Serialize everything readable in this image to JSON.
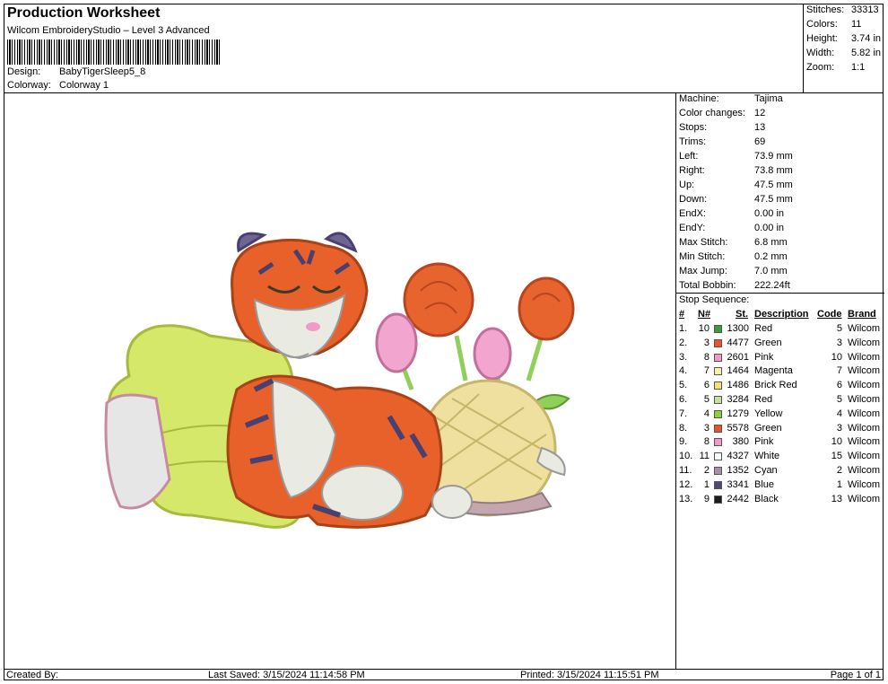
{
  "header": {
    "title": "Production Worksheet",
    "subtitle": "Wilcom EmbroideryStudio – Level 3 Advanced",
    "design_label": "Design:",
    "design_value": "BabyTigerSleep5_8",
    "colorway_label": "Colorway:",
    "colorway_value": "Colorway 1"
  },
  "top_stats": [
    {
      "label": "Stitches:",
      "value": "33313"
    },
    {
      "label": "Colors:",
      "value": "11"
    },
    {
      "label": "Height:",
      "value": "3.74 in"
    },
    {
      "label": "Width:",
      "value": "5.82 in"
    },
    {
      "label": "Zoom:",
      "value": "1:1"
    }
  ],
  "machine_stats": [
    {
      "label": "Machine:",
      "value": "Tajima"
    },
    {
      "label": "Color changes:",
      "value": "12"
    },
    {
      "label": "Stops:",
      "value": "13"
    },
    {
      "label": "Trims:",
      "value": "69"
    },
    {
      "label": "Left:",
      "value": "73.9 mm"
    },
    {
      "label": "Right:",
      "value": "73.8 mm"
    },
    {
      "label": "Up:",
      "value": "47.5 mm"
    },
    {
      "label": "Down:",
      "value": "47.5 mm"
    },
    {
      "label": "EndX:",
      "value": "0.00 in"
    },
    {
      "label": "EndY:",
      "value": "0.00 in"
    },
    {
      "label": "Max Stitch:",
      "value": "6.8 mm"
    },
    {
      "label": "Min Stitch:",
      "value": "0.2 mm"
    },
    {
      "label": "Max Jump:",
      "value": "7.0 mm"
    },
    {
      "label": "Total Bobbin:",
      "value": "222.24ft"
    }
  ],
  "stop_sequence": {
    "title": "Stop Sequence:",
    "columns": {
      "num": "#",
      "n": "N#",
      "st": "St.",
      "desc": "Description",
      "code": "Code",
      "brand": "Brand"
    },
    "rows": [
      {
        "num": "1.",
        "n": "10",
        "color": "#3c9a3a",
        "st": "1300",
        "desc": "Red",
        "code": "5",
        "brand": "Wilcom"
      },
      {
        "num": "2.",
        "n": "3",
        "color": "#e8532a",
        "st": "4477",
        "desc": "Green",
        "code": "3",
        "brand": "Wilcom"
      },
      {
        "num": "3.",
        "n": "8",
        "color": "#f29ac7",
        "st": "2601",
        "desc": "Pink",
        "code": "10",
        "brand": "Wilcom"
      },
      {
        "num": "4.",
        "n": "7",
        "color": "#faf0a8",
        "st": "1464",
        "desc": "Magenta",
        "code": "7",
        "brand": "Wilcom"
      },
      {
        "num": "5.",
        "n": "6",
        "color": "#f6e07a",
        "st": "1486",
        "desc": "Brick Red",
        "code": "6",
        "brand": "Wilcom"
      },
      {
        "num": "6.",
        "n": "5",
        "color": "#c9e29a",
        "st": "3284",
        "desc": "Red",
        "code": "5",
        "brand": "Wilcom"
      },
      {
        "num": "7.",
        "n": "4",
        "color": "#8fcf3a",
        "st": "1279",
        "desc": "Yellow",
        "code": "4",
        "brand": "Wilcom"
      },
      {
        "num": "8.",
        "n": "3",
        "color": "#e8532a",
        "st": "5578",
        "desc": "Green",
        "code": "3",
        "brand": "Wilcom"
      },
      {
        "num": "9.",
        "n": "8",
        "color": "#f29ac7",
        "st": "380",
        "desc": "Pink",
        "code": "10",
        "brand": "Wilcom"
      },
      {
        "num": "10.",
        "n": "11",
        "color": "#ffffff",
        "st": "4327",
        "desc": "White",
        "code": "15",
        "brand": "Wilcom"
      },
      {
        "num": "11.",
        "n": "2",
        "color": "#a78fa6",
        "st": "1352",
        "desc": "Cyan",
        "code": "2",
        "brand": "Wilcom"
      },
      {
        "num": "12.",
        "n": "1",
        "color": "#4a4a72",
        "st": "3341",
        "desc": "Blue",
        "code": "1",
        "brand": "Wilcom"
      },
      {
        "num": "13.",
        "n": "9",
        "color": "#1a1a1a",
        "st": "2442",
        "desc": "Black",
        "code": "13",
        "brand": "Wilcom"
      }
    ]
  },
  "footer": {
    "created": "Created By:",
    "last_saved": "Last Saved: 3/15/2024 11:14:58 PM",
    "printed": "Printed: 3/15/2024 11:15:51 PM",
    "page": "Page 1 of 1"
  },
  "colors": {
    "tiger_orange": "#e8602a",
    "stripe": "#4a4070",
    "pillow": "#d6e86a",
    "rose": "#e8642e",
    "tulip": "#f2a6cf",
    "stem": "#8fcf5a",
    "turtle": "#efe0a0",
    "fur": "#e9ebe2"
  }
}
